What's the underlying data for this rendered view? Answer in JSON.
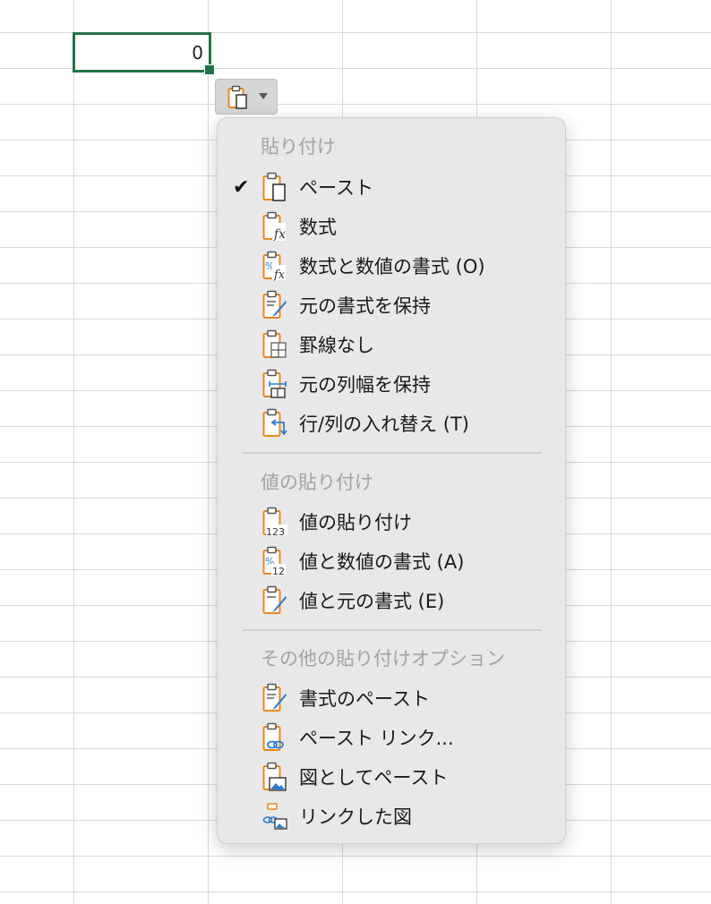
{
  "sheet": {
    "active_cell_value": "0",
    "paste_options_icon": "clipboard-icon",
    "paste_options_caret": "chevron-down-icon"
  },
  "menu": {
    "sections": [
      {
        "header": "貼り付け",
        "items": [
          {
            "label": "ペースト",
            "icon": "paste-icon",
            "checked": true
          },
          {
            "label": "数式",
            "icon": "paste-formulas-icon"
          },
          {
            "label": "数式と数値の書式 (O)",
            "icon": "paste-formulas-number-format-icon"
          },
          {
            "label": "元の書式を保持",
            "icon": "paste-keep-source-formatting-icon"
          },
          {
            "label": "罫線なし",
            "icon": "paste-no-borders-icon"
          },
          {
            "label": "元の列幅を保持",
            "icon": "paste-keep-column-widths-icon"
          },
          {
            "label": "行/列の入れ替え (T)",
            "icon": "paste-transpose-icon"
          }
        ]
      },
      {
        "header": "値の貼り付け",
        "items": [
          {
            "label": "値の貼り付け",
            "icon": "paste-values-icon"
          },
          {
            "label": "値と数値の書式 (A)",
            "icon": "paste-values-number-format-icon"
          },
          {
            "label": "値と元の書式 (E)",
            "icon": "paste-values-source-formatting-icon"
          }
        ]
      },
      {
        "header": "その他の貼り付けオプション",
        "items": [
          {
            "label": "書式のペースト",
            "icon": "paste-formatting-icon"
          },
          {
            "label": "ペースト リンク...",
            "icon": "paste-link-icon"
          },
          {
            "label": "図としてペースト",
            "icon": "paste-picture-icon"
          },
          {
            "label": "リンクした図",
            "icon": "linked-picture-icon"
          }
        ]
      }
    ]
  },
  "colors": {
    "cell_border": "#217346",
    "clipboard_orange": "#e8891c",
    "icon_blue": "#2b7cd3",
    "menu_bg": "#e8e8e8",
    "header_gray": "#a3a3a3"
  }
}
